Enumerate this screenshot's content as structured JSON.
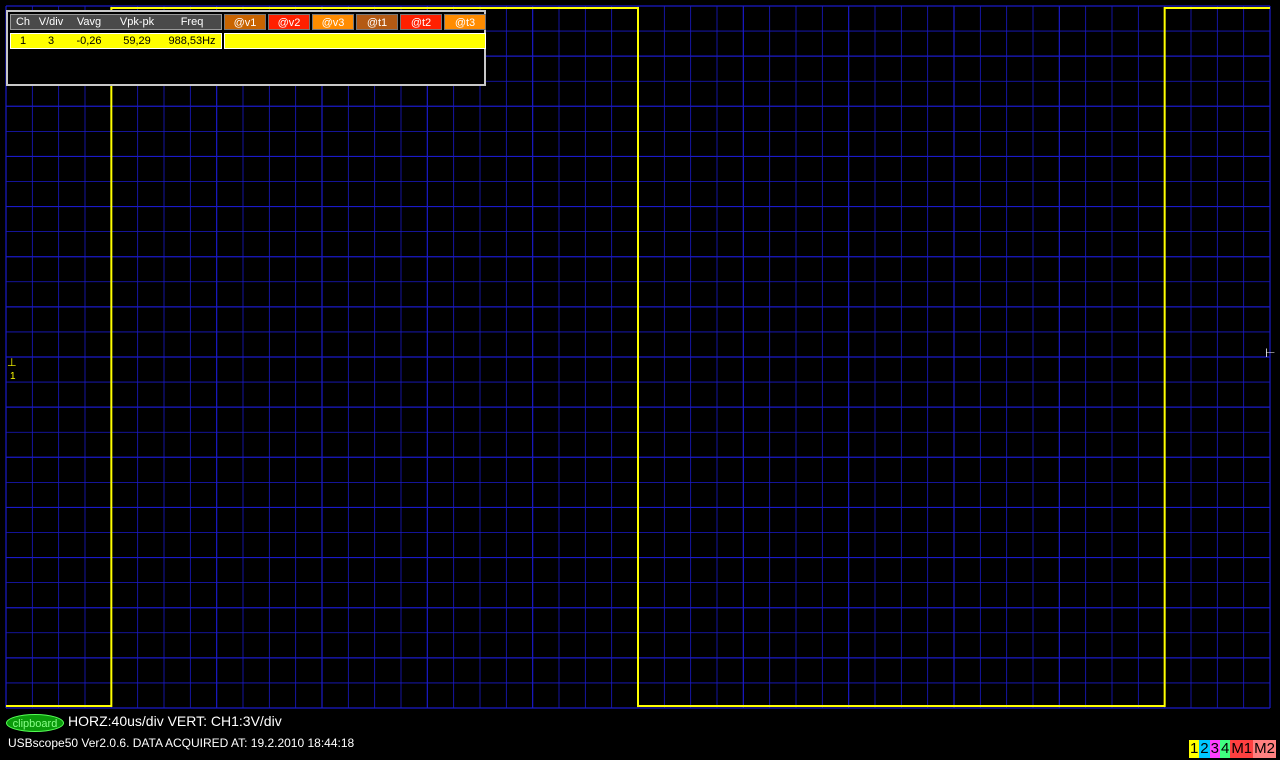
{
  "colors": {
    "background": "#000000",
    "grid": "#1a1ac8",
    "trace": "#ffff00",
    "panel_border": "#c8c8c8"
  },
  "measurement_panel": {
    "headers": [
      "Ch",
      "V/div",
      "Vavg",
      "Vpk-pk",
      "Freq"
    ],
    "cursor_buttons": [
      {
        "label": "@v1",
        "color": "#c86400"
      },
      {
        "label": "@v2",
        "color": "#ff2000"
      },
      {
        "label": "@v3",
        "color": "#ff8c00"
      },
      {
        "label": "@t1",
        "color": "#b45a14"
      },
      {
        "label": "@t2",
        "color": "#ff2000"
      },
      {
        "label": "@t3",
        "color": "#ff8c00"
      }
    ],
    "rows": [
      {
        "ch": "1",
        "vdiv": "3",
        "vavg": "-0,26",
        "vpkpk": "59,29",
        "freq": "988,53Hz"
      }
    ]
  },
  "trace": {
    "channel": 1,
    "waveform": "square",
    "segments": [
      {
        "level": "low",
        "from_div": 0.0,
        "to_div": 1.0
      },
      {
        "level": "high",
        "from_div": 1.0,
        "to_div": 6.0
      },
      {
        "level": "low",
        "from_div": 6.0,
        "to_div": 11.0
      },
      {
        "level": "high",
        "from_div": 11.0,
        "to_div": 12.0
      }
    ]
  },
  "grid": {
    "h_divisions": 12,
    "v_divisions": 14
  },
  "markers": {
    "ground_label": "1",
    "trigger_left": "⊥",
    "trigger_right": "⊢"
  },
  "footer": {
    "clipboard_label": "clipboard",
    "scale_text": "HORZ:40us/div VERT: CH1:3V/div",
    "status_text": "USBscope50 Ver2.0.6.  DATA ACQUIRED AT: 19.2.2010 18:44:18",
    "legend": [
      {
        "label": "1",
        "color": "#ffff00"
      },
      {
        "label": "2",
        "color": "#00c8ff"
      },
      {
        "label": "3",
        "color": "#ff40ff"
      },
      {
        "label": "4",
        "color": "#40ff80"
      },
      {
        "label": "M1",
        "color": "#ff4040"
      },
      {
        "label": "M2",
        "color": "#ff8080"
      }
    ]
  }
}
